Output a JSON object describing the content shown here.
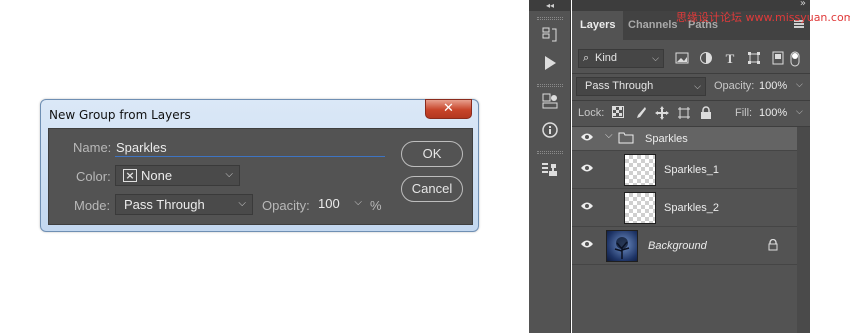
{
  "dialog": {
    "title": "New Group from Layers",
    "close_symbol": "✕",
    "name_label": "Name:",
    "name_value": "Sparkles",
    "color_label": "Color:",
    "color_value": "None",
    "mode_label": "Mode:",
    "mode_value": "Pass Through",
    "opacity_label": "Opacity:",
    "opacity_value": "100",
    "opacity_unit": "%",
    "ok_label": "OK",
    "cancel_label": "Cancel"
  },
  "toolbar": {
    "collapse_symbol": "◂◂",
    "tools": [
      "history-icon",
      "play-actions-icon",
      "properties-icon",
      "info-icon",
      "clone-source-icon"
    ]
  },
  "watermark": "思缘设计论坛 www.missyuan.com",
  "layers_panel": {
    "tabs": [
      "Layers",
      "Channels",
      "Paths"
    ],
    "active_tab": "Layers",
    "filter_kind": "Kind",
    "blend_mode": "Pass Through",
    "opacity_label": "Opacity:",
    "opacity_value": "100%",
    "lock_label": "Lock:",
    "fill_label": "Fill:",
    "fill_value": "100%",
    "layers": [
      {
        "name": "Sparkles",
        "type": "group",
        "visible": true,
        "expanded": true
      },
      {
        "name": "Sparkles_1",
        "type": "layer",
        "visible": true
      },
      {
        "name": "Sparkles_2",
        "type": "layer",
        "visible": true
      },
      {
        "name": "Background",
        "type": "background",
        "visible": true,
        "locked": true
      }
    ]
  },
  "colors": {
    "panel_bg": "#535353",
    "accent_blue": "#3e74c2",
    "close_red": "#c7442a"
  }
}
